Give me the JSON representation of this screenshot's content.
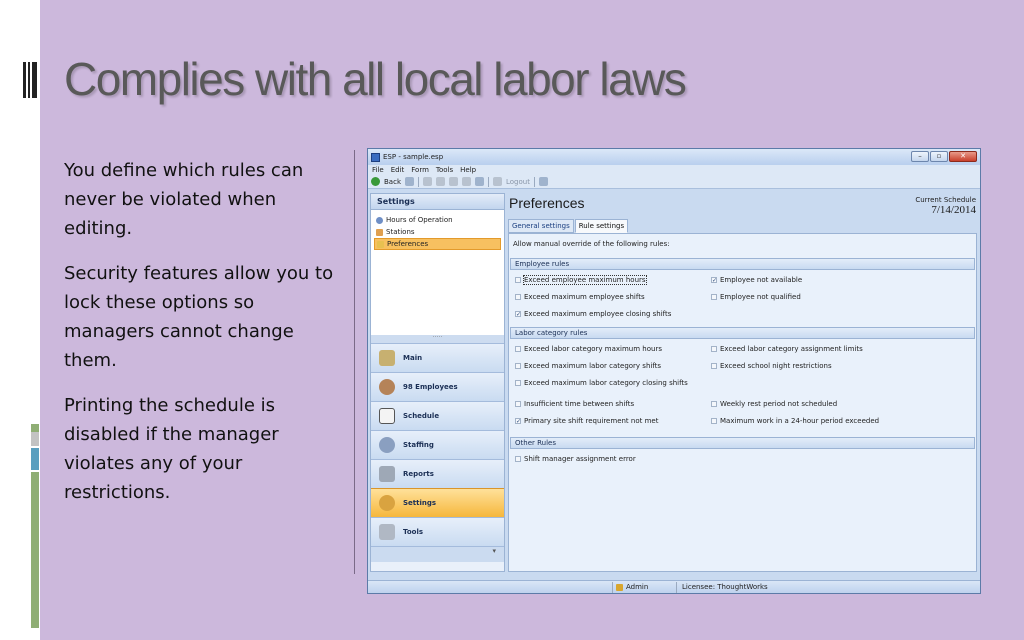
{
  "slide": {
    "title": "Complies with all local labor laws",
    "bullets": [
      "You define which rules can never be violated when editing.",
      "Security features allow you to lock these options so managers cannot change them.",
      "Printing the schedule is disabled if the manager violates any of your restrictions."
    ],
    "accent_colors": [
      "#8fae74",
      "#c3c3c3",
      "#5a9fbf",
      "#8fae74"
    ]
  },
  "window": {
    "title": "ESP - sample.esp",
    "controls": [
      "minimize",
      "maximize",
      "close"
    ],
    "menu": [
      "File",
      "Edit",
      "Form",
      "Tools",
      "Help"
    ],
    "toolbar": {
      "back_label": "Back",
      "logout_label": "Logout"
    }
  },
  "sidebar": {
    "header": "Settings",
    "items": [
      {
        "label": "Hours of Operation",
        "icon": "clock-icon"
      },
      {
        "label": "Stations",
        "icon": "hand-icon"
      },
      {
        "label": "Preferences",
        "icon": "preferences-icon",
        "selected": true
      }
    ],
    "nav": [
      {
        "label": "Main",
        "icon": "main-icon"
      },
      {
        "label": "98 Employees",
        "icon": "employees-icon"
      },
      {
        "label": "Schedule",
        "icon": "calendar-icon"
      },
      {
        "label": "Staffing",
        "icon": "staffing-icon"
      },
      {
        "label": "Reports",
        "icon": "printer-icon"
      },
      {
        "label": "Settings",
        "icon": "gear-icon",
        "selected": true
      },
      {
        "label": "Tools",
        "icon": "tools-icon"
      }
    ]
  },
  "main": {
    "title": "Preferences",
    "current_schedule_label": "Current Schedule",
    "current_schedule_date": "7/14/2014",
    "tabs": [
      {
        "label": "General settings",
        "active": false
      },
      {
        "label": "Rule settings",
        "active": true
      }
    ],
    "intro": "Allow manual override of the following rules:",
    "sections": {
      "employee": "Employee rules",
      "labor": "Labor category rules",
      "other": "Other Rules"
    },
    "rules": {
      "emp_max_hours": {
        "label": "Exceed employee maximum hours",
        "checked": false
      },
      "emp_not_available": {
        "label": "Employee not available",
        "checked": true
      },
      "max_emp_shifts": {
        "label": "Exceed maximum employee shifts",
        "checked": false
      },
      "emp_not_qualified": {
        "label": "Employee not qualified",
        "checked": false
      },
      "max_emp_closing": {
        "label": "Exceed maximum employee closing shifts",
        "checked": true
      },
      "labor_max_hours": {
        "label": "Exceed labor category maximum hours",
        "checked": false
      },
      "labor_assign_limits": {
        "label": "Exceed labor category assignment limits",
        "checked": false
      },
      "labor_max_shifts": {
        "label": "Exceed maximum labor category shifts",
        "checked": false
      },
      "school_night": {
        "label": "Exceed school night restrictions",
        "checked": false
      },
      "labor_closing": {
        "label": "Exceed maximum labor category closing shifts",
        "checked": false
      },
      "insufficient_time": {
        "label": "Insufficient time between shifts",
        "checked": false
      },
      "weekly_rest": {
        "label": "Weekly rest period not scheduled",
        "checked": false
      },
      "primary_site": {
        "label": "Primary site shift requirement not met",
        "checked": true
      },
      "max_work_24": {
        "label": "Maximum work in a 24-hour period exceeded",
        "checked": false
      },
      "shift_manager": {
        "label": "Shift manager assignment error",
        "checked": false
      }
    }
  },
  "status": {
    "user": "Admin",
    "licensee": "Licensee: ThoughtWorks"
  }
}
